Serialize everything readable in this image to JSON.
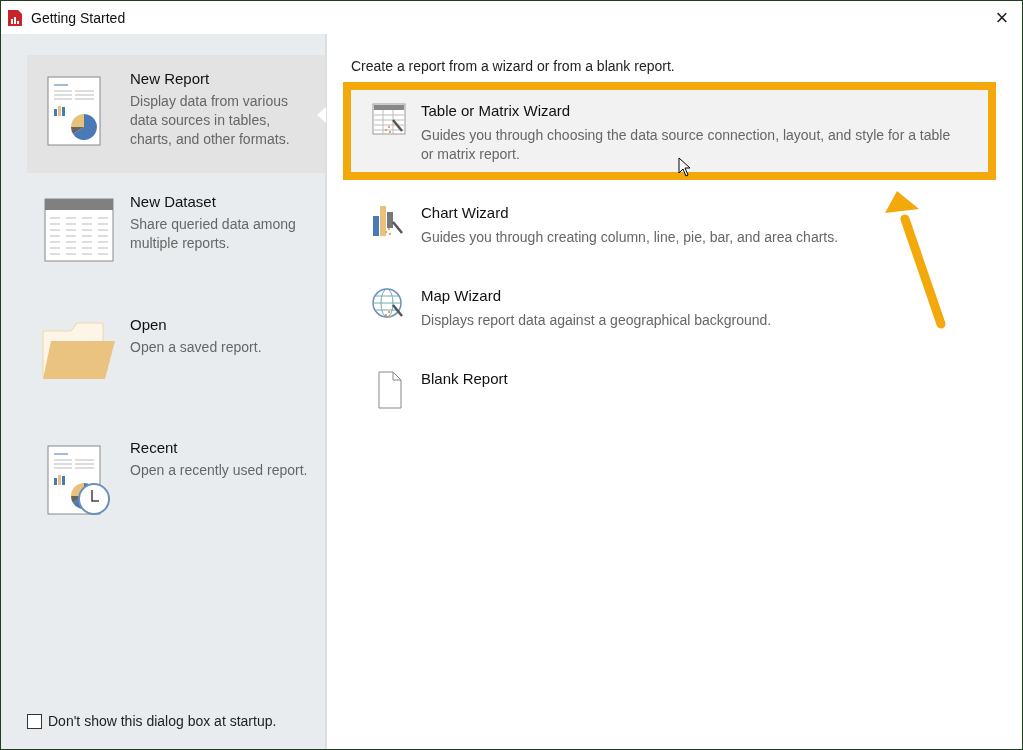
{
  "window": {
    "title": "Getting Started",
    "close": "×"
  },
  "sidebar": {
    "items": [
      {
        "kind": "report",
        "title": "New Report",
        "description": "Display data from various data sources in tables, charts, and other formats.",
        "selected": true
      },
      {
        "kind": "dataset",
        "title": "New Dataset",
        "description": "Share queried data among multiple reports.",
        "selected": false
      },
      {
        "kind": "open",
        "title": "Open",
        "description": "Open a saved report.",
        "selected": false
      },
      {
        "kind": "recent",
        "title": "Recent",
        "description": "Open a recently used report.",
        "selected": false
      }
    ],
    "startup_checkbox": {
      "label": "Don't show this dialog box at startup.",
      "checked": false
    }
  },
  "content": {
    "heading": "Create a report from a wizard or from a blank report.",
    "options": [
      {
        "kind": "table",
        "title": "Table or Matrix Wizard",
        "description": "Guides you through choosing the data source connection, layout, and style for a table or matrix report.",
        "selected": true,
        "highlighted": true
      },
      {
        "kind": "chart",
        "title": "Chart Wizard",
        "description": "Guides you through creating column, line, pie, bar, and area charts.",
        "selected": false,
        "highlighted": false
      },
      {
        "kind": "map",
        "title": "Map Wizard",
        "description": "Displays report data against a geographical background.",
        "selected": false,
        "highlighted": false
      },
      {
        "kind": "blank",
        "title": "Blank Report",
        "selected": false,
        "highlighted": false
      }
    ]
  }
}
